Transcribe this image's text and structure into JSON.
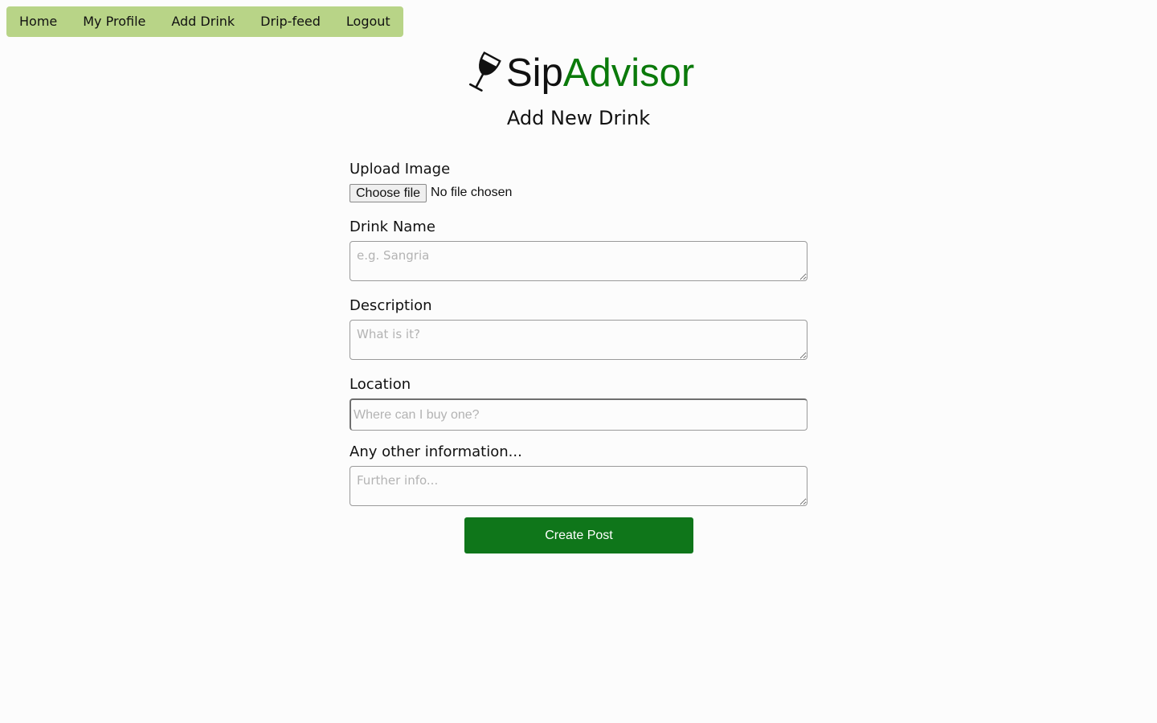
{
  "nav": {
    "items": [
      {
        "label": "Home"
      },
      {
        "label": "My Profile"
      },
      {
        "label": "Add Drink"
      },
      {
        "label": "Drip-feed"
      },
      {
        "label": "Logout"
      }
    ]
  },
  "brand": {
    "part1": "Sip",
    "part2": "Advisor",
    "icon": "wine-glass-icon",
    "accent_color": "#0b7a0b"
  },
  "page": {
    "title": "Add New Drink"
  },
  "form": {
    "upload": {
      "label": "Upload Image",
      "button_label": "Choose file",
      "status": "No file chosen"
    },
    "drink_name": {
      "label": "Drink Name",
      "placeholder": "e.g. Sangria",
      "value": ""
    },
    "description": {
      "label": "Description",
      "placeholder": "What is it?",
      "value": ""
    },
    "location": {
      "label": "Location",
      "placeholder": "Where can I buy one?",
      "value": ""
    },
    "other_info": {
      "label": "Any other information...",
      "placeholder": "Further info...",
      "value": ""
    },
    "submit_label": "Create Post"
  },
  "colors": {
    "nav_background": "#b8d487",
    "submit_background": "#0f761a",
    "page_background": "#fcfcfc"
  }
}
